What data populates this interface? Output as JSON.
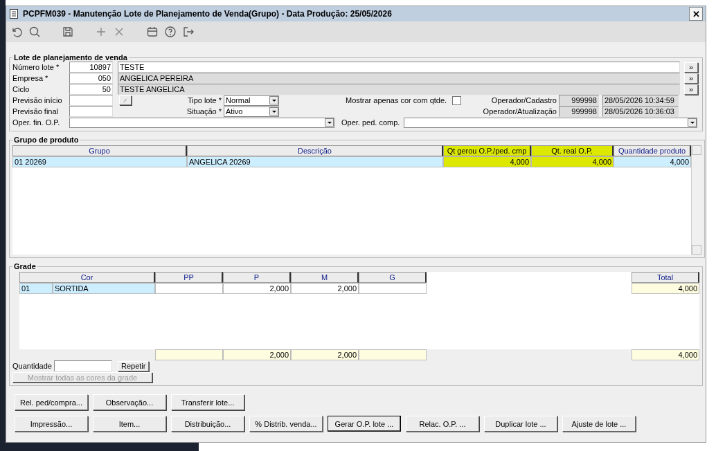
{
  "window": {
    "title": "PCPFM039 - Manutenção Lote de Planejamento de Venda(Grupo) - Data Produção: 25/05/2026",
    "close": "✕"
  },
  "lote": {
    "title": "Lote de planejamento de venda",
    "lookups": [
      {
        "label": "Número lote *",
        "code": "10897",
        "description": "TESTE",
        "editable": true,
        "button": "»"
      },
      {
        "label": "Empresa *",
        "code": "050",
        "description": "ANGELICA PEREIRA",
        "editable": false,
        "button": "»"
      },
      {
        "label": "Ciclo",
        "code": "50",
        "description": "TESTE ANGELICA",
        "editable": false,
        "button": "»"
      }
    ],
    "previsao_inicio": {
      "label": "Previsão início",
      "button": "⁄⁄"
    },
    "previsao_final": {
      "label": "Previsão final"
    },
    "tipo_lote": {
      "label": "Tipo lote *",
      "value": "Normal"
    },
    "situacao": {
      "label": "Situação *",
      "value": "Ativo"
    },
    "mostrar_cor": {
      "label": "Mostrar apenas cor com qtde.",
      "checked": false
    },
    "operador_cadastro": {
      "label": "Operador/Cadastro",
      "code": "999998",
      "date": "28/05/2026 10:34:59"
    },
    "operador_atualizacao": {
      "label": "Operador/Atualização",
      "code": "999998",
      "date": "28/05/2026 10:36:03"
    },
    "oper_fin_op": {
      "label": "Oper. fin. O.P."
    },
    "oper_ped_comp": {
      "label": "Oper. ped. comp."
    }
  },
  "grupo": {
    "title": "Grupo de produto",
    "columns": [
      {
        "label": "Grupo",
        "highlighted": false
      },
      {
        "label": "Descrição",
        "highlighted": false
      },
      {
        "label": "Qt gerou O.P./ped. cmp",
        "highlighted": true
      },
      {
        "label": "Qt. real O.P.",
        "highlighted": true
      },
      {
        "label": "Quantidade produto",
        "highlighted": false
      }
    ],
    "rows": [
      {
        "selected": true,
        "cells": [
          "01 20269",
          "ANGELICA 20269",
          "4,000",
          "4,000",
          "4,000"
        ]
      }
    ]
  },
  "grade": {
    "title": "Grade",
    "columns": [
      "Cor",
      "PP",
      "P",
      "M",
      "G"
    ],
    "total_label": "Total",
    "rows": [
      {
        "selected": true,
        "code": "01",
        "cor": "SORTIDA",
        "sizes": {
          "p": "2,000",
          "m": "2,000"
        },
        "total": "4,000"
      }
    ],
    "totals": {
      "p": "2,000",
      "m": "2,000"
    },
    "grand_total": "4,000",
    "quantidade_label": "Quantidade",
    "repetir": "Repetir",
    "mostrar_todas": {
      "label": "Mostrar todas as cores da grade",
      "disabled": true
    }
  },
  "buttons": [
    [
      {
        "label": "Rel. ped/compra...",
        "default": false
      },
      {
        "label": "Observação...",
        "default": false
      },
      {
        "label": "Transferir lote...",
        "default": false
      }
    ],
    [
      {
        "label": "Impressão...",
        "default": false
      },
      {
        "label": "Item...",
        "default": false
      },
      {
        "label": "Distribuição...",
        "default": false
      },
      {
        "label": "% Distrib. venda...",
        "default": false
      },
      {
        "label": "Gerar O.P.  lote ...",
        "default": true
      },
      {
        "label": "Relac. O.P. ...",
        "default": false
      },
      {
        "label": "Duplicar lote ...",
        "default": false
      },
      {
        "label": "Ajuste de lote ...",
        "default": false
      }
    ]
  ]
}
